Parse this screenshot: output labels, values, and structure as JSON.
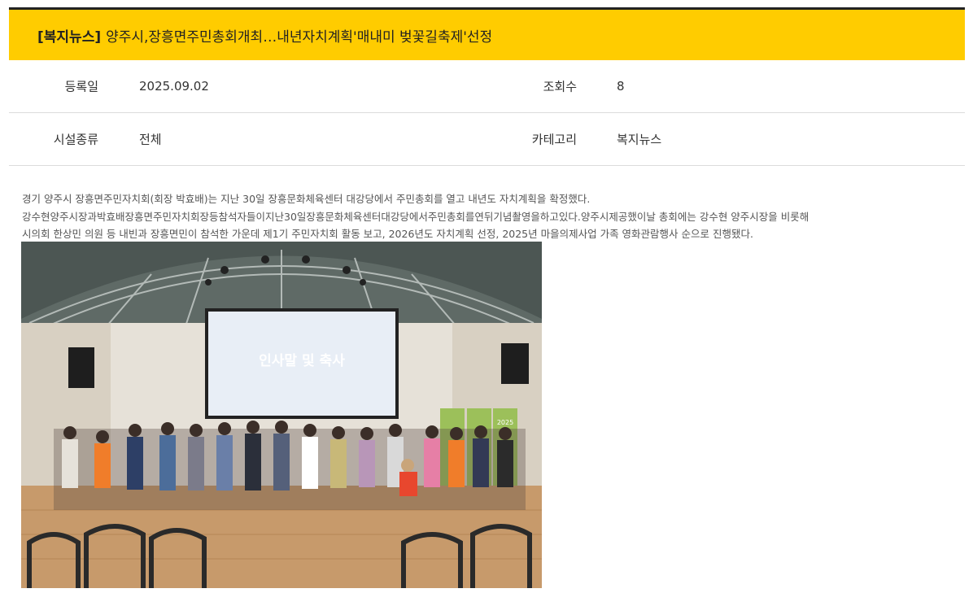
{
  "post": {
    "category": "[복지뉴스]",
    "title": "양주시,장흥면주민총회개최…내년자치계획'매내미 벚꽃길축제'선정"
  },
  "meta": {
    "date_label": "등록일",
    "date_value": "2025.09.02",
    "views_label": "조회수",
    "views_value": "8",
    "facility_label": "시설종류",
    "facility_value": "전체",
    "category_label": "카테고리",
    "category_value": "복지뉴스"
  },
  "content": {
    "lines": [
      "경기 양주시 장흥면주민자치회(회장 박효배)는 지난 30일 장흥문화체육센터 대강당에서 주민총회를 열고 내년도 자치계획을 확정했다.",
      "강수현양주시장과박효배장흥면주민자치회장등참석자들이지난30일장흥문화체육센터대강당에서주민총회를연뒤기념촬영을하고있다.양주시제공했이날 총회에는 강수현 양주시장을 비롯해",
      "시의회 한상민 의원 등 내빈과 장흥면민이 참석한 가운데 제1기 주민자치회 활동 보고, 2026년도 자치계획 선정, 2025년 마을의제사업 가족 영화관람행사 순으로 진행됐다."
    ],
    "photo": {
      "screen_text": "인사말 및 축사",
      "banner_text": "2025"
    }
  }
}
